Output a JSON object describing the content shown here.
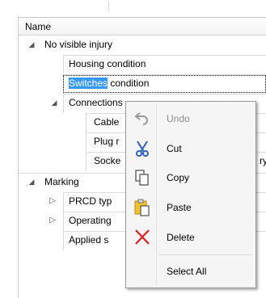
{
  "column": {
    "name": "Name"
  },
  "rows": [
    {
      "level": 0,
      "expander": "expanded",
      "label": "No visible injury"
    },
    {
      "level": 1,
      "expander": "none",
      "label": "Housing condition"
    },
    {
      "level": 1,
      "expander": "none",
      "label_selected": "Switches",
      "label_rest": " condition"
    },
    {
      "level": 1,
      "expander": "expanded",
      "label": "Connections"
    },
    {
      "level": 2,
      "expander": "none",
      "label": "Cable"
    },
    {
      "level": 2,
      "expander": "none",
      "label": "Plug r"
    },
    {
      "level": 2,
      "expander": "none",
      "label": "Socke",
      "label_tail": "ry"
    },
    {
      "level": 0,
      "expander": "expanded",
      "label": "Marking"
    },
    {
      "level": 1,
      "expander": "collapsed",
      "label": "PRCD typ"
    },
    {
      "level": 1,
      "expander": "collapsed",
      "label": "Operating"
    },
    {
      "level": 1,
      "expander": "none",
      "label": "Applied s"
    }
  ],
  "context_menu": {
    "items": [
      {
        "label": "Undo",
        "icon": "undo-icon",
        "enabled": false
      },
      {
        "label": "Cut",
        "icon": "scissors-icon",
        "enabled": true
      },
      {
        "label": "Copy",
        "icon": "copy-icon",
        "enabled": true
      },
      {
        "label": "Paste",
        "icon": "paste-icon",
        "enabled": true
      },
      {
        "label": "Delete",
        "icon": "delete-x-icon",
        "enabled": true
      },
      {
        "label": "Select All",
        "icon": "",
        "enabled": true
      }
    ]
  },
  "colors": {
    "selection": "#3399ff",
    "delete_red": "#e02020",
    "cut_blue": "#2f5fb8",
    "paste_yellow": "#f2c230"
  }
}
